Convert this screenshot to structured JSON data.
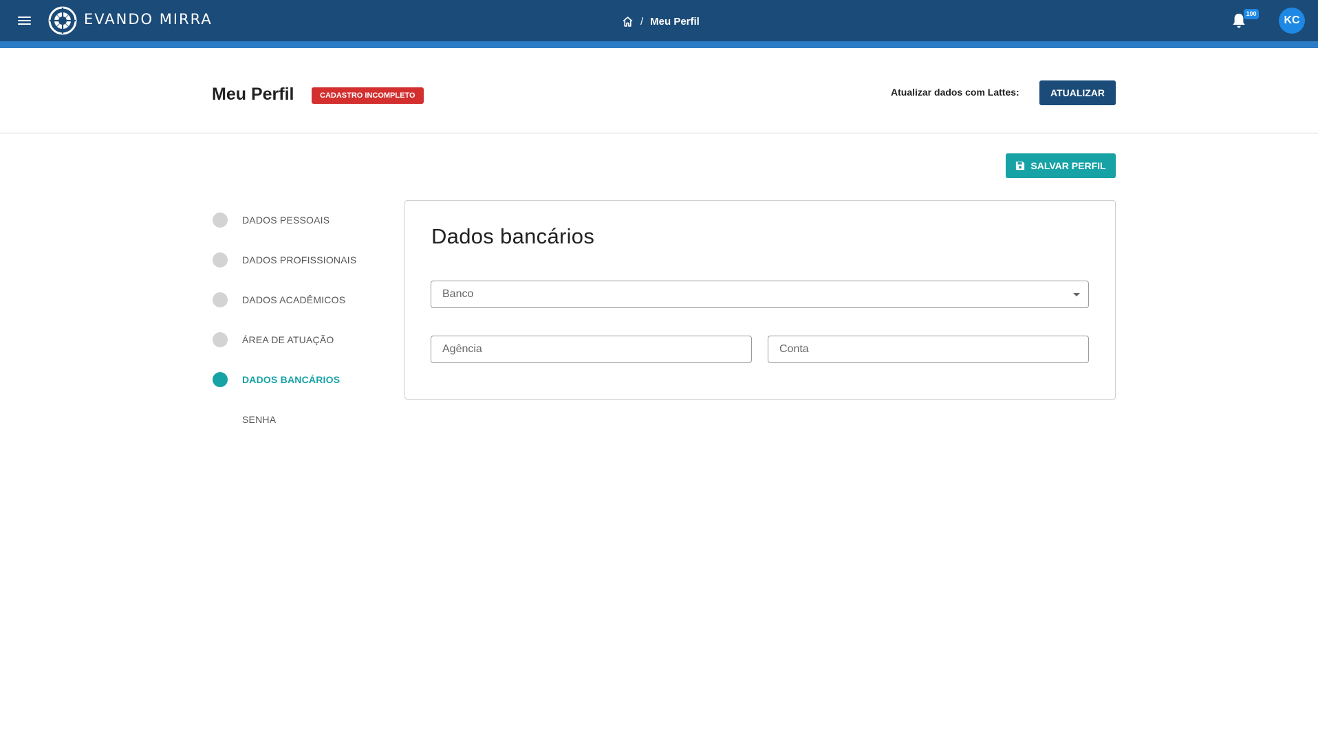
{
  "topbar": {
    "menu_icon": "hamburger-menu-icon",
    "logo_icon": "evando-mirra-logo-mark",
    "logo_text": "EVANDO MIRRA",
    "breadcrumb": {
      "home_icon": "home-icon",
      "separator": "/",
      "current": "Meu Perfil"
    },
    "notifications": {
      "icon": "bell-icon",
      "badge": "100"
    },
    "avatar_initials": "KC",
    "colors": {
      "bar": "#1b4b78",
      "accent_strip": "#2b7cc4",
      "avatar": "#1e88e5"
    }
  },
  "header": {
    "title": "Meu Perfil",
    "status_badge": "CADASTRO INCOMPLETO",
    "lattes_label": "Atualizar dados com Lattes:",
    "update_button": "ATUALIZAR"
  },
  "actions": {
    "save_button": "SALVAR PERFIL",
    "save_icon": "floppy-disk-icon"
  },
  "steps": [
    {
      "label": "DADOS PESSOAIS",
      "state": "pending"
    },
    {
      "label": "DADOS PROFISSIONAIS",
      "state": "pending"
    },
    {
      "label": "DADOS ACADÊMICOS",
      "state": "pending"
    },
    {
      "label": "ÁREA DE ATUAÇÃO",
      "state": "pending"
    },
    {
      "label": "DADOS BANCÁRIOS",
      "state": "active"
    },
    {
      "label": "SENHA",
      "state": "none"
    }
  ],
  "card": {
    "title": "Dados bancários",
    "fields": {
      "bank": {
        "placeholder": "Banco",
        "value": ""
      },
      "agency": {
        "placeholder": "Agência",
        "value": ""
      },
      "account": {
        "placeholder": "Conta",
        "value": ""
      }
    }
  },
  "colors": {
    "primary": "#1b4b78",
    "teal": "#17a2a6",
    "badge_red": "#d32f2f",
    "step_inactive": "#d3d3d3"
  }
}
